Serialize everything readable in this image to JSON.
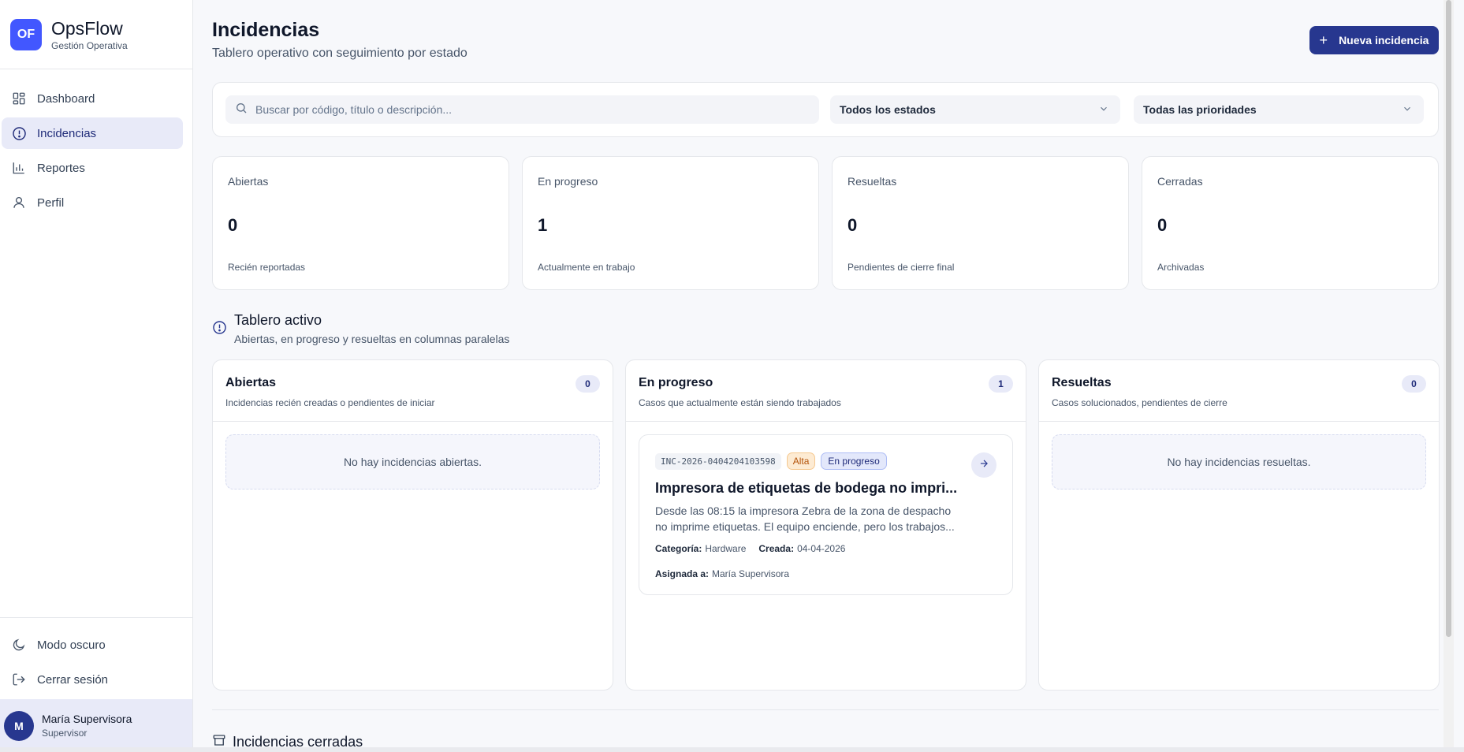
{
  "brand": {
    "logo": "OF",
    "name": "OpsFlow",
    "subtitle": "Gestión Operativa"
  },
  "nav": [
    {
      "label": "Dashboard",
      "icon": "dashboard-icon",
      "active": false
    },
    {
      "label": "Incidencias",
      "icon": "alert-circle-icon",
      "active": true
    },
    {
      "label": "Reportes",
      "icon": "bar-chart-icon",
      "active": false
    },
    {
      "label": "Perfil",
      "icon": "user-icon",
      "active": false
    }
  ],
  "sidebar_bottom": {
    "dark_mode": "Modo oscuro",
    "logout": "Cerrar sesión"
  },
  "user": {
    "initial": "M",
    "name": "María Supervisora",
    "role": "Supervisor"
  },
  "header": {
    "title": "Incidencias",
    "subtitle": "Tablero operativo con seguimiento por estado",
    "new_button": "Nueva incidencia"
  },
  "filters": {
    "search_placeholder": "Buscar por código, título o descripción...",
    "status": "Todos los estados",
    "priority": "Todas las prioridades"
  },
  "stats": [
    {
      "label": "Abiertas",
      "value": "0",
      "desc": "Recién reportadas"
    },
    {
      "label": "En progreso",
      "value": "1",
      "desc": "Actualmente en trabajo"
    },
    {
      "label": "Resueltas",
      "value": "0",
      "desc": "Pendientes de cierre final"
    },
    {
      "label": "Cerradas",
      "value": "0",
      "desc": "Archivadas"
    }
  ],
  "board": {
    "title": "Tablero activo",
    "subtitle": "Abiertas, en progreso y resueltas en columnas paralelas",
    "columns": [
      {
        "title": "Abiertas",
        "subtitle": "Incidencias recién creadas o pendientes de iniciar",
        "count": "0",
        "empty": "No hay incidencias abiertas."
      },
      {
        "title": "En progreso",
        "subtitle": "Casos que actualmente están siendo trabajados",
        "count": "1"
      },
      {
        "title": "Resueltas",
        "subtitle": "Casos solucionados, pendientes de cierre",
        "count": "0",
        "empty": "No hay incidencias resueltas."
      }
    ],
    "card": {
      "code": "INC-2026-0404204103598",
      "priority": "Alta",
      "status": "En progreso",
      "title": "Impresora de etiquetas de bodega no impri...",
      "desc_line1": "Desde las 08:15 la impresora Zebra de la zona de despacho",
      "desc_line2": "no imprime etiquetas. El equipo enciende, pero los trabajos...",
      "category_label": "Categoría:",
      "category": "Hardware",
      "created_label": "Creada:",
      "created": "04-04-2026",
      "assigned_label": "Asignada a:",
      "assigned": "María Supervisora"
    }
  },
  "closed": {
    "title": "Incidencias cerradas"
  },
  "colors": {
    "primary": "#27378f",
    "logo": "#4257ff",
    "active_bg": "#e8eaf8"
  }
}
